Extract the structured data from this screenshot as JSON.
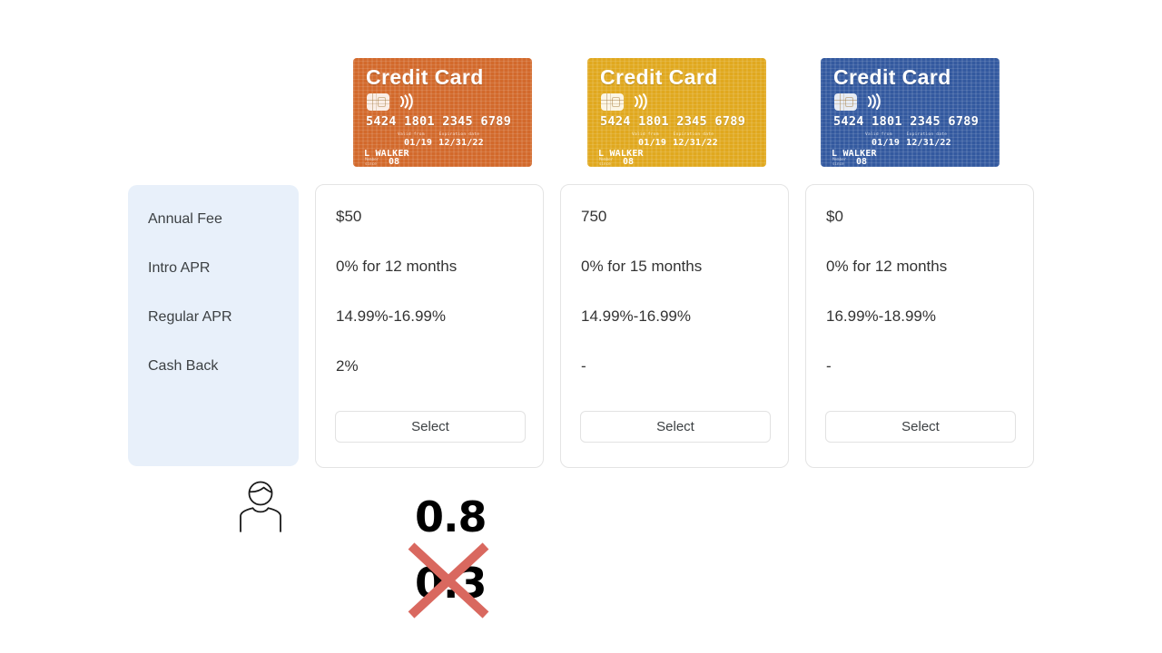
{
  "cards": [
    {
      "brand_label": "Credit Card",
      "color": "#d2692b",
      "number": "5424 1801 2345 6789",
      "valid_from_label": "Valid from",
      "expiration_label": "Expiration date",
      "valid_from": "01/19",
      "expiration": "12/31/22",
      "holder": "L WALKER",
      "member_since_label_line1": "Member",
      "member_since_label_line2": "since",
      "member_since": "08"
    },
    {
      "brand_label": "Credit Card",
      "color": "#e0a81e",
      "number": "5424 1801 2345 6789",
      "valid_from_label": "Valid from",
      "expiration_label": "Expiration date",
      "valid_from": "01/19",
      "expiration": "12/31/22",
      "holder": "L WALKER",
      "member_since_label_line1": "Member",
      "member_since_label_line2": "since",
      "member_since": "08"
    },
    {
      "brand_label": "Credit Card",
      "color": "#33599f",
      "number": "5424 1801 2345 6789",
      "valid_from_label": "Valid from",
      "expiration_label": "Expiration date",
      "valid_from": "01/19",
      "expiration": "12/31/22",
      "holder": "L WALKER",
      "member_since_label_line1": "Member",
      "member_since_label_line2": "since",
      "member_since": "08"
    }
  ],
  "comparison": {
    "row_labels": [
      "Annual Fee",
      "Intro APR",
      "Regular APR",
      "Cash Back"
    ],
    "columns": [
      {
        "values": [
          "$50",
          "0% for 12 months",
          "14.99%-16.99%",
          "2%"
        ],
        "select_label": "Select"
      },
      {
        "values": [
          "750",
          "0% for 15 months",
          "14.99%-16.99%",
          "-"
        ],
        "select_label": "Select"
      },
      {
        "values": [
          "$0",
          "0% for 12 months",
          "16.99%-18.99%",
          "-"
        ],
        "select_label": "Select"
      }
    ]
  },
  "annotation": {
    "person_icon": "person-avatar-icon",
    "score_selected": "0.8",
    "score_rejected": "0.3",
    "cross_out_color": "#d9685f"
  },
  "theme": {
    "label_panel_bg": "#e8f0fa",
    "label_text": "#3c4043",
    "value_text": "#333333",
    "card_border": "#e4e4e4",
    "button_border": "#e2e2e2",
    "page_bg": "#ffffff"
  }
}
